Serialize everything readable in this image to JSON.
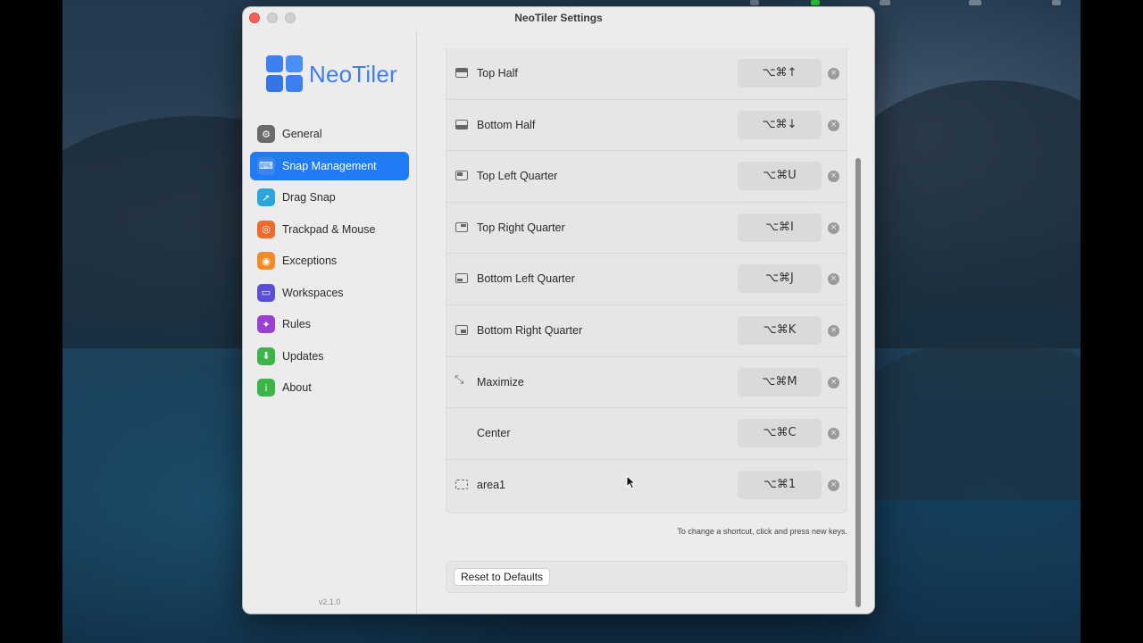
{
  "window": {
    "title": "NeoTiler Settings"
  },
  "sidebar": {
    "app_name": "NeoTiler",
    "version": "v2.1.0",
    "items": [
      {
        "label": "General",
        "icon": "gear-icon",
        "color": "#6b6b6b",
        "glyph": "⚙",
        "active": false
      },
      {
        "label": "Snap Management",
        "icon": "keyboard-icon",
        "color": "#3a86f0",
        "glyph": "⌨",
        "active": true
      },
      {
        "label": "Drag Snap",
        "icon": "pointer-icon",
        "color": "#2aa6d9",
        "glyph": "➚",
        "active": false
      },
      {
        "label": "Trackpad & Mouse",
        "icon": "trackpad-icon",
        "color": "#ef6a2c",
        "glyph": "◎",
        "active": false
      },
      {
        "label": "Exceptions",
        "icon": "eye-icon",
        "color": "#f08b2a",
        "glyph": "◉",
        "active": false
      },
      {
        "label": "Workspaces",
        "icon": "window-icon",
        "color": "#5a4fd6",
        "glyph": "▭",
        "active": false
      },
      {
        "label": "Rules",
        "icon": "wand-icon",
        "color": "#9b3fd4",
        "glyph": "✦",
        "active": false
      },
      {
        "label": "Updates",
        "icon": "download-icon",
        "color": "#3bb54a",
        "glyph": "⬇",
        "active": false
      },
      {
        "label": "About",
        "icon": "info-icon",
        "color": "#3bb54a",
        "glyph": "i",
        "active": false
      }
    ]
  },
  "shortcuts": [
    {
      "label": "Top Half",
      "keys": "⌥⌘↑",
      "icon": "top-half-icon"
    },
    {
      "label": "Bottom Half",
      "keys": "⌥⌘↓",
      "icon": "bottom-half-icon"
    },
    {
      "label": "Top Left Quarter",
      "keys": "⌥⌘U",
      "icon": "top-left-quarter-icon"
    },
    {
      "label": "Top Right Quarter",
      "keys": "⌥⌘I",
      "icon": "top-right-quarter-icon"
    },
    {
      "label": "Bottom Left Quarter",
      "keys": "⌥⌘J",
      "icon": "bottom-left-quarter-icon"
    },
    {
      "label": "Bottom Right Quarter",
      "keys": "⌥⌘K",
      "icon": "bottom-right-quarter-icon"
    },
    {
      "label": "Maximize",
      "keys": "⌥⌘M",
      "icon": "maximize-icon"
    },
    {
      "label": "Center",
      "keys": "⌥⌘C",
      "icon": ""
    },
    {
      "label": "area1",
      "keys": "⌥⌘1",
      "icon": "custom-area-icon"
    }
  ],
  "hint": "To change a shortcut, click and press new keys.",
  "reset_label": "Reset to Defaults"
}
